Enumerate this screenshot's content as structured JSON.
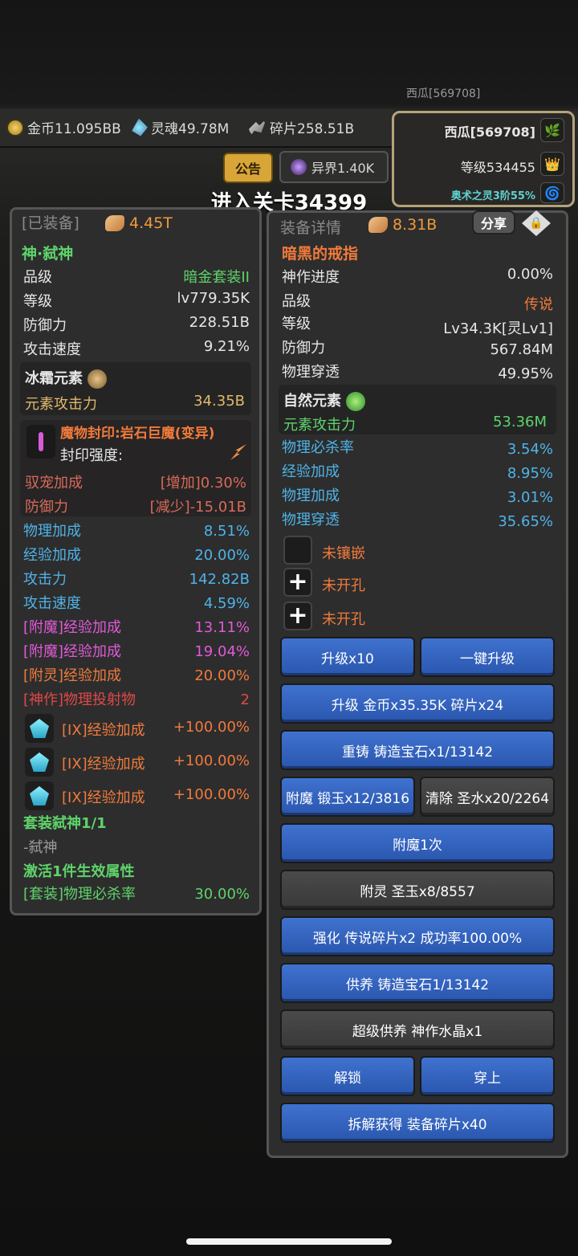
{
  "top": {
    "bg_name": "西瓜[569708]",
    "gold": "金币11.095BB",
    "soul": "灵魂49.78M",
    "fragments": "碎片258.51B",
    "notice": "公告",
    "otherworld": "异界1.40K",
    "stage": "进入关卡34399"
  },
  "profile": {
    "name": "西瓜[569708]",
    "level": "等级534455",
    "arcane": "奥术之灵3阶55%"
  },
  "left": {
    "header": "[已装备]",
    "power": "4.45T",
    "item_name": "神·弑神",
    "stats": [
      {
        "k": "品级",
        "v": "暗金套装II"
      },
      {
        "k": "等级",
        "v": "lv779.35K"
      },
      {
        "k": "防御力",
        "v": "228.51B"
      },
      {
        "k": "攻击速度",
        "v": "9.21%"
      }
    ],
    "element": {
      "name": "冰霜元素",
      "k": "元素攻击力",
      "v": "34.35B"
    },
    "seal": {
      "title": "魔物封印:岩石巨魔(变异)",
      "strength": "封印强度:",
      "rows": [
        {
          "k": "驭宠加成",
          "v": "[增加]0.30%"
        },
        {
          "k": "防御力",
          "v": "[减少]-15.01B"
        }
      ]
    },
    "bonus": [
      {
        "k": "物理加成",
        "v": "8.51%"
      },
      {
        "k": "经验加成",
        "v": "20.00%"
      },
      {
        "k": "攻击力",
        "v": "142.82B"
      },
      {
        "k": "攻击速度",
        "v": "4.59%"
      }
    ],
    "enchant": [
      {
        "k": "[附魔]经验加成",
        "v": "13.11%"
      },
      {
        "k": "[附魔]经验加成",
        "v": "19.04%"
      },
      {
        "k": "[附灵]经验加成",
        "v": "20.00%"
      },
      {
        "k": "[神作]物理投射物",
        "v": "2"
      }
    ],
    "gems": [
      {
        "k": "[IX]经验加成",
        "v": "+100.00%"
      },
      {
        "k": "[IX]经验加成",
        "v": "+100.00%"
      },
      {
        "k": "[IX]经验加成",
        "v": "+100.00%"
      }
    ],
    "set": {
      "title": "套装弑神1/1",
      "member": "-弑神",
      "activate": "激活1件生效属性",
      "k": "[套装]物理必杀率",
      "v": "30.00%"
    }
  },
  "right": {
    "header": "装备详情",
    "power": "8.31B",
    "share": "分享",
    "item_name": "暗黑的戒指",
    "stats": [
      {
        "k": "神作进度",
        "v": "0.00%"
      },
      {
        "k": "品级",
        "v": "传说"
      },
      {
        "k": "等级",
        "v": "Lv34.3K[灵Lv1]"
      },
      {
        "k": "防御力",
        "v": "567.84M"
      },
      {
        "k": "物理穿透",
        "v": "49.95%"
      }
    ],
    "element": {
      "name": "自然元素",
      "k": "元素攻击力",
      "v": "53.36M"
    },
    "bonus": [
      {
        "k": "物理必杀率",
        "v": "3.54%"
      },
      {
        "k": "经验加成",
        "v": "8.95%"
      },
      {
        "k": "物理加成",
        "v": "3.01%"
      },
      {
        "k": "物理穿透",
        "v": "35.65%"
      }
    ],
    "sockets": [
      "未镶嵌",
      "未开孔",
      "未开孔"
    ],
    "buttons": {
      "up10": "升级x10",
      "upall": "一键升级",
      "upgrade": "升级 金币x35.35K 碎片x24",
      "reforge": "重铸 铸造宝石x1/13142",
      "enchant": "附魔 锻玉x12/3816",
      "clear": "清除 圣水x20/2264",
      "enchant1": "附魔1次",
      "spirit": "附灵 圣玉x8/8557",
      "strengthen": "强化 传说碎片x2 成功率100.00%",
      "feed": "供养 铸造宝石1/13142",
      "superfeed": "超级供养 神作水晶x1",
      "unlock": "解锁",
      "equip": "穿上",
      "dismantle": "拆解获得 装备碎片x40"
    }
  },
  "colors": {
    "blue_button": "#3a6cc9",
    "gray_button": "#444444",
    "green": "#5ed36a",
    "cyan": "#4fb3e8",
    "orange": "#f07a3c",
    "purple": "#e05ad8"
  }
}
